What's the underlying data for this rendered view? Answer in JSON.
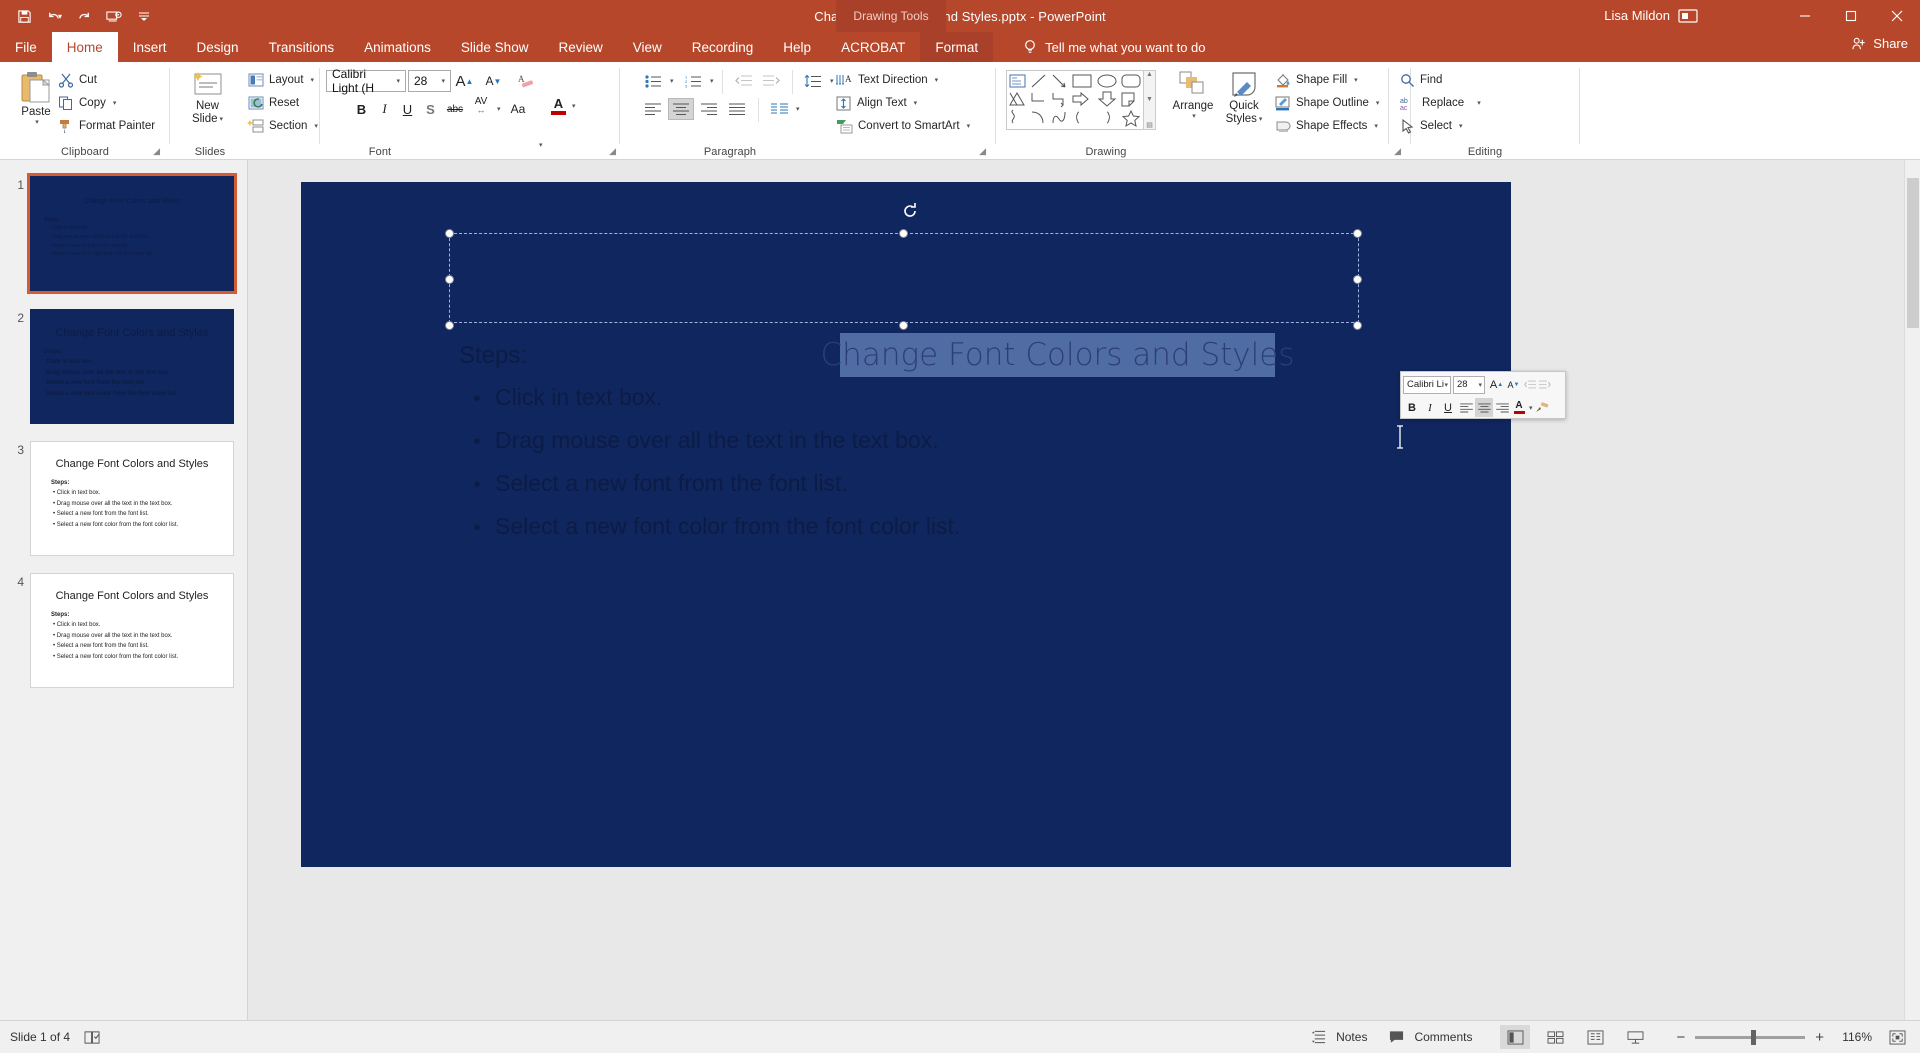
{
  "titlebar": {
    "document_title": "Change Font Colors and Styles.pptx  -  PowerPoint",
    "context_tab_group": "Drawing Tools",
    "user_name": "Lisa Mildon",
    "qat": [
      {
        "name": "save",
        "label": "Save"
      },
      {
        "name": "undo",
        "label": "Undo"
      },
      {
        "name": "redo",
        "label": "Redo"
      },
      {
        "name": "start-from-beginning",
        "label": "Start From Beginning"
      },
      {
        "name": "customize-quick-access-toolbar",
        "label": "Customize Quick Access Toolbar"
      }
    ],
    "window_buttons": [
      {
        "name": "ribbon-display-options",
        "glyph": "⬚"
      },
      {
        "name": "minimize",
        "glyph": "─"
      },
      {
        "name": "restore",
        "glyph": "❐"
      },
      {
        "name": "close",
        "glyph": "✕"
      }
    ]
  },
  "tabs": [
    {
      "label": "File",
      "active": false,
      "context": false
    },
    {
      "label": "Home",
      "active": true,
      "context": false
    },
    {
      "label": "Insert",
      "active": false,
      "context": false
    },
    {
      "label": "Design",
      "active": false,
      "context": false
    },
    {
      "label": "Transitions",
      "active": false,
      "context": false
    },
    {
      "label": "Animations",
      "active": false,
      "context": false
    },
    {
      "label": "Slide Show",
      "active": false,
      "context": false
    },
    {
      "label": "Review",
      "active": false,
      "context": false
    },
    {
      "label": "View",
      "active": false,
      "context": false
    },
    {
      "label": "Recording",
      "active": false,
      "context": false
    },
    {
      "label": "Help",
      "active": false,
      "context": false
    },
    {
      "label": "ACROBAT",
      "active": false,
      "context": false
    },
    {
      "label": "Format",
      "active": false,
      "context": true
    }
  ],
  "tell_me": {
    "placeholder": "Tell me what you want to do"
  },
  "share": {
    "label": "Share"
  },
  "ribbon": {
    "groups": [
      {
        "name": "clipboard",
        "label": "Clipboard"
      },
      {
        "name": "slides",
        "label": "Slides"
      },
      {
        "name": "font",
        "label": "Font"
      },
      {
        "name": "paragraph",
        "label": "Paragraph"
      },
      {
        "name": "drawing",
        "label": "Drawing"
      },
      {
        "name": "editing",
        "label": "Editing"
      }
    ],
    "clipboard": {
      "paste": "Paste",
      "cut": "Cut",
      "copy": "Copy",
      "format_painter": "Format Painter"
    },
    "slides": {
      "new_slide": "New\nSlide",
      "new_slide_line1": "New",
      "new_slide_line2": "Slide",
      "layout": "Layout",
      "reset": "Reset",
      "section": "Section"
    },
    "font": {
      "font_name": "Calibri Light (H",
      "font_size": "28",
      "increase_size": "A",
      "decrease_size": "A",
      "clear_formatting": "Clear All Formatting",
      "bold": "B",
      "italic": "I",
      "underline": "U",
      "shadow": "S",
      "strikethrough": "abc",
      "character_spacing": "AV",
      "change_case": "Aa",
      "font_color": "A"
    },
    "paragraph": {
      "bullets": "Bullets",
      "numbering": "Numbering",
      "decrease_indent": "Decrease List Level",
      "increase_indent": "Increase List Level",
      "line_spacing": "Line Spacing",
      "align_left": "Align Left",
      "align_center": "Center",
      "align_right": "Align Right",
      "justify": "Justify",
      "columns": "Columns",
      "text_direction": "Text Direction",
      "align_text": "Align Text",
      "convert_to_smartart": "Convert to SmartArt"
    },
    "drawing": {
      "arrange": "Arrange",
      "quick_styles_line1": "Quick",
      "quick_styles_line2": "Styles",
      "shape_fill": "Shape Fill",
      "shape_outline": "Shape Outline",
      "shape_effects": "Shape Effects"
    },
    "editing": {
      "find": "Find",
      "replace": "Replace",
      "select": "Select"
    }
  },
  "thumbnails": [
    {
      "number": "1",
      "selected": true,
      "theme": "dark",
      "title": "Change Font Colors and Styles",
      "steps_label": "Steps:",
      "steps": [
        "Click in text box.",
        "Drag mouse over all the text in the text box.",
        "Select a new font from the font list.",
        "Select a new font color from the font color list."
      ]
    },
    {
      "number": "2",
      "selected": false,
      "theme": "dark",
      "title": "Change Font Colors and Styles",
      "steps_label": "Steps:",
      "steps": [
        "Click in text box.",
        "Drag mouse over all the text in the text box.",
        "Select a new font from the font list.",
        "Select a new font color from the font color list."
      ]
    },
    {
      "number": "3",
      "selected": false,
      "theme": "light",
      "title": "Change Font Colors and Styles",
      "steps_label": "Steps:",
      "steps": [
        "Click in text box.",
        "Drag mouse over all the text in the text box.",
        "Select a new font from the font list.",
        "Select a new font color from the font color list."
      ]
    },
    {
      "number": "4",
      "selected": false,
      "theme": "light",
      "title": "Change Font Colors and Styles",
      "steps_label": "Steps:",
      "steps": [
        "Click in text box.",
        "Drag mouse over all the text in the text box.",
        "Select a new font from the font list.",
        "Select a new font color from the font color list."
      ]
    }
  ],
  "slide": {
    "title_text": "Change Font Colors and Styles",
    "steps_label": "Steps:",
    "bullet_char": "•",
    "bullets": [
      "Click in text box.",
      "Drag mouse over all the text in the text box.",
      "Select a new font from the font list.",
      "Select a new font color from the font color list."
    ]
  },
  "mini_toolbar": {
    "font_name": "Calibri Li",
    "font_size": "28",
    "grow_font": "A",
    "shrink_font": "A",
    "decrease_indent": "Decrease List Level",
    "increase_indent": "Increase List Level",
    "bold": "B",
    "italic": "I",
    "underline": "U",
    "align_left": "Align Left",
    "align_center": "Center",
    "align_right": "Align Right",
    "font_color": "A",
    "format_painter": "Format Painter"
  },
  "statusbar": {
    "slide_indicator": "Slide 1 of 4",
    "accessibility": "Accessibility Checker",
    "notes": "Notes",
    "comments": "Comments",
    "views": [
      {
        "name": "normal-view",
        "active": true
      },
      {
        "name": "slide-sorter-view",
        "active": false
      },
      {
        "name": "reading-view",
        "active": false
      },
      {
        "name": "slide-show-view",
        "active": false
      }
    ],
    "zoom_out": "−",
    "zoom_in": "+",
    "zoom_level": "116%",
    "fit_to_window": "Fit slide to current window"
  },
  "colors": {
    "brand": "#b7472a",
    "context_tab": "#a8402a",
    "slide_bg": "#10265e",
    "selection_highlight": "#4f6da4",
    "thumb_selected_border": "#d45b32"
  }
}
